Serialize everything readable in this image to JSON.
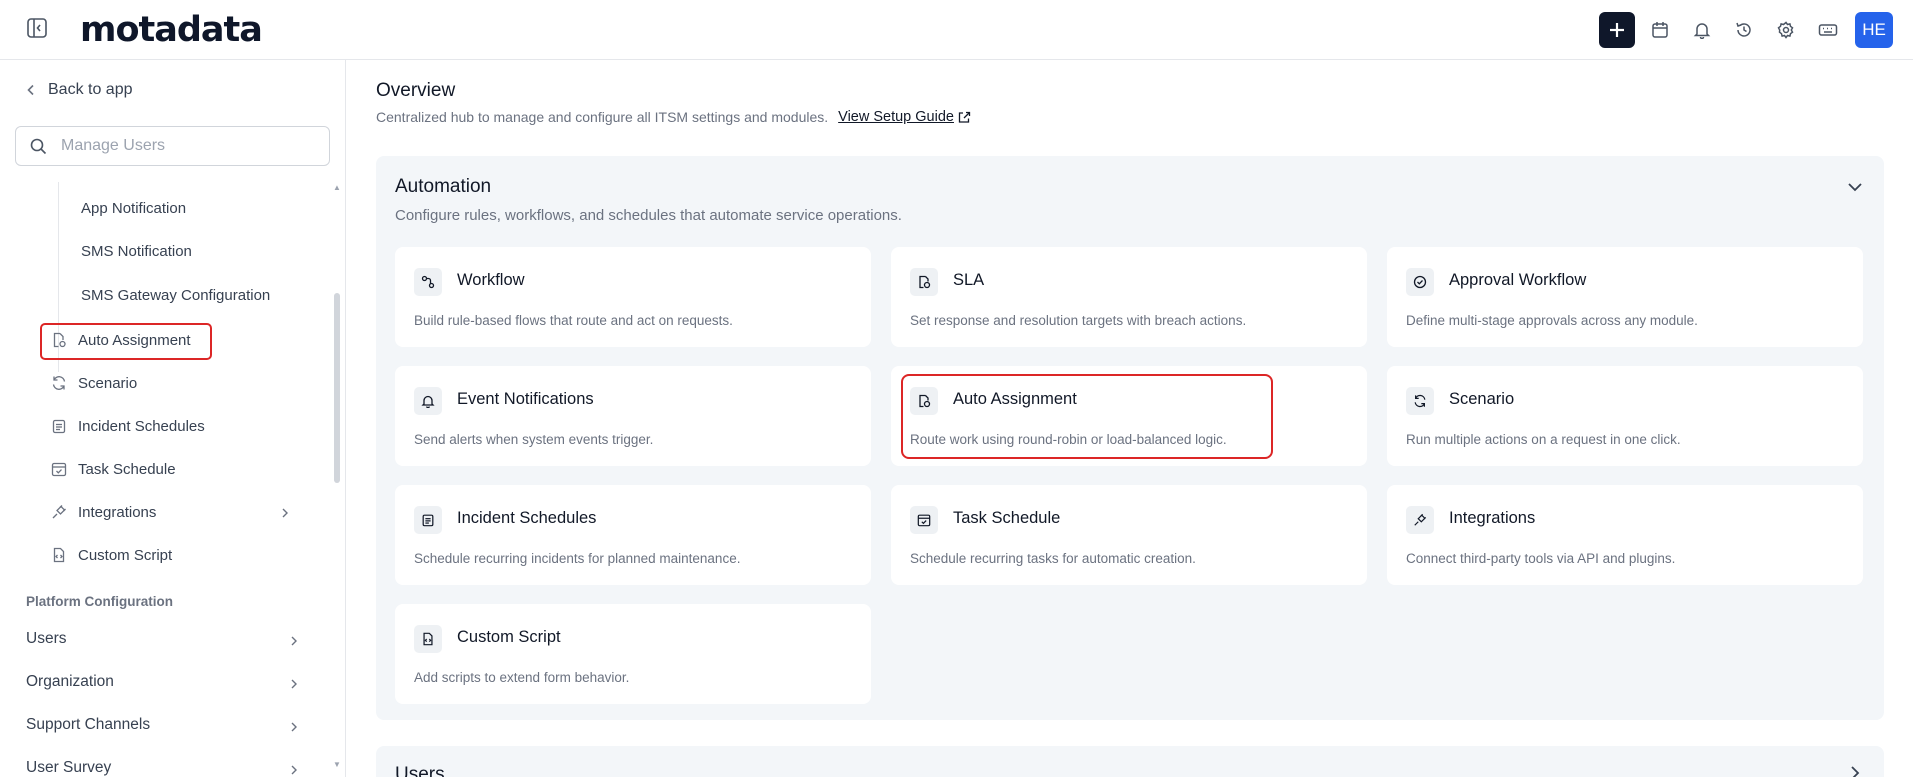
{
  "header": {
    "logo": "motadata",
    "avatar": "HE",
    "icons": [
      "sidebar-toggle-icon",
      "plus-icon",
      "calendar-icon",
      "bell-icon",
      "history-icon",
      "gear-icon",
      "keyboard-icon"
    ]
  },
  "sidebar": {
    "back_label": "Back to app",
    "search_placeholder": "Manage Users",
    "sub_items": [
      "App Notification",
      "SMS Notification",
      "SMS Gateway Configuration"
    ],
    "items": [
      {
        "label": "Auto Assignment",
        "icon": "auto-assignment-icon"
      },
      {
        "label": "Scenario",
        "icon": "refresh-icon"
      },
      {
        "label": "Incident Schedules",
        "icon": "clipboard-icon"
      },
      {
        "label": "Task Schedule",
        "icon": "calendar-check-icon"
      },
      {
        "label": "Integrations",
        "icon": "plug-icon"
      },
      {
        "label": "Custom Script",
        "icon": "script-icon"
      }
    ],
    "section_label": "Platform Configuration",
    "platform_items": [
      "Users",
      "Organization",
      "Support Channels",
      "User Survey"
    ]
  },
  "main": {
    "title": "Overview",
    "subtitle": "Centralized hub to manage and configure all ITSM settings and modules.",
    "guide_label": "View Setup Guide",
    "automation": {
      "title": "Automation",
      "subtitle": "Configure rules, workflows, and schedules that automate service operations.",
      "cards": [
        {
          "title": "Workflow",
          "desc": "Build rule-based flows that route and act on requests.",
          "icon": "workflow-icon"
        },
        {
          "title": "SLA",
          "desc": "Set response and resolution targets with breach actions.",
          "icon": "sla-icon"
        },
        {
          "title": "Approval Workflow",
          "desc": "Define multi-stage approvals across any module.",
          "icon": "check-circle-icon"
        },
        {
          "title": "Event Notifications",
          "desc": "Send alerts when system events trigger.",
          "icon": "bell-icon"
        },
        {
          "title": "Auto Assignment",
          "desc": "Route work using round-robin or load-balanced logic.",
          "icon": "auto-assignment-icon"
        },
        {
          "title": "Scenario",
          "desc": "Run multiple actions on a request in one click.",
          "icon": "refresh-icon"
        },
        {
          "title": "Incident Schedules",
          "desc": "Schedule recurring incidents for planned maintenance.",
          "icon": "clipboard-icon"
        },
        {
          "title": "Task Schedule",
          "desc": "Schedule recurring tasks for automatic creation.",
          "icon": "calendar-check-icon"
        },
        {
          "title": "Integrations",
          "desc": "Connect third-party tools via API and plugins.",
          "icon": "plug-icon"
        },
        {
          "title": "Custom Script",
          "desc": "Add scripts to extend form behavior.",
          "icon": "script-icon"
        }
      ]
    },
    "users_panel_title": "Users"
  }
}
